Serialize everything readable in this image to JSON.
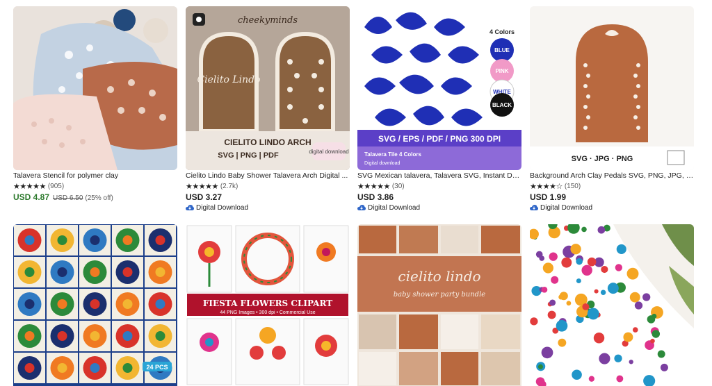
{
  "listings": [
    {
      "title": "Talavera Stencil for polymer clay",
      "stars": "★★★★★",
      "reviews": "(905)",
      "price": "USD 4.87",
      "original_price": "USD 6.50",
      "discount": "(25% off)"
    },
    {
      "title": "Cielito Lindo Baby Shower Talavera Arch Digital ...",
      "stars": "★★★★★",
      "reviews": "(2.7k)",
      "price": "USD 3.27",
      "badge": "Digital Download",
      "image_text": {
        "brand": "cheekyminds",
        "script": "Cielito Lindo",
        "heading": "CIELITO LINDO ARCH",
        "formats": "SVG | PNG | PDF",
        "tag": "digital download"
      }
    },
    {
      "title": "SVG Mexican talavera, Talavera SVG, Instant Do...",
      "stars": "★★★★★",
      "reviews": "(30)",
      "price": "USD 3.86",
      "badge": "Digital Download",
      "image_text": {
        "colors_label": "4 Colors",
        "colors": [
          "BLUE",
          "PINK",
          "WHITE",
          "BLACK"
        ],
        "banner": "SVG / EPS / PDF / PNG 300 DPI",
        "sub": "Talavera Tile 4 Colors",
        "sub2": "Digital download"
      }
    },
    {
      "title": "Background Arch Clay Pedals SVG, PNG, JPG, Ins...",
      "stars": "★★★★☆",
      "reviews": "(150)",
      "price": "USD 1.99",
      "badge": "Digital Download",
      "image_text": {
        "formats": "SVG · JPG · PNG"
      }
    },
    {
      "image_text": {
        "pcs": "24 PCS"
      }
    },
    {
      "image_text": {
        "heading": "FIESTA FLOWERS CLIPART",
        "sub": "44 PNG Images  •  300 dpi  •  Commercial Use"
      }
    },
    {
      "image_text": {
        "script": "cielito lindo",
        "sub": "baby shower party bundle"
      }
    },
    {
      "image_text": {}
    }
  ],
  "colors": {
    "sale_green": "#2d7a2d",
    "badge_blue": "#2f66c8",
    "terracotta": "#b9693f",
    "talavera_blue": "#1f2fb5"
  }
}
